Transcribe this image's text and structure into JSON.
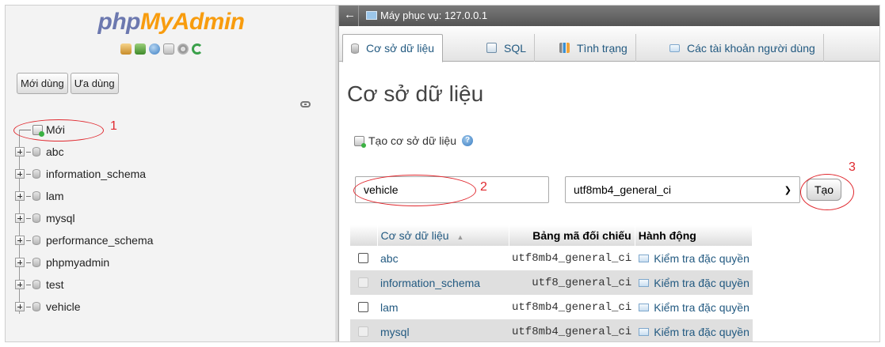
{
  "logo": {
    "php": "php",
    "myadmin": "MyAdmin"
  },
  "nav": {
    "icons": [
      "home-icon",
      "exit-icon",
      "help-icon",
      "docs-icon",
      "settings-icon",
      "reload-icon"
    ],
    "buttons": {
      "recent": "Mới dùng",
      "favorites": "Ưa dùng"
    },
    "new_label": "Mới",
    "databases": [
      "abc",
      "information_schema",
      "lam",
      "mysql",
      "performance_schema",
      "phpmyadmin",
      "test",
      "vehicle"
    ]
  },
  "topbar": {
    "server": "Máy phục vụ: 127.0.0.1"
  },
  "tabs": [
    {
      "label": "Cơ sở dữ liệu",
      "icon": "database-icon",
      "active": true
    },
    {
      "label": "SQL",
      "icon": "sql-icon",
      "active": false
    },
    {
      "label": "Tình trạng",
      "icon": "status-icon",
      "active": false
    },
    {
      "label": "Các tài khoản người dùng",
      "icon": "users-icon",
      "active": false
    }
  ],
  "main": {
    "title": "Cơ sở dữ liệu",
    "create_heading": "Tạo cơ sở dữ liệu",
    "db_name_value": "vehicle",
    "collation_selected": "utf8mb4_general_ci",
    "create_button": "Tạo"
  },
  "table": {
    "headers": {
      "name": "Cơ sở dữ liệu",
      "sort_indicator": "▲",
      "collation": "Bảng mã đối chiếu",
      "action": "Hành động"
    },
    "rows": [
      {
        "name": "abc",
        "collation": "utf8mb4_general_ci",
        "action": "Kiểm tra đặc quyền",
        "checkbox_disabled": false
      },
      {
        "name": "information_schema",
        "collation": "utf8_general_ci",
        "action": "Kiểm tra đặc quyền",
        "checkbox_disabled": true
      },
      {
        "name": "lam",
        "collation": "utf8mb4_general_ci",
        "action": "Kiểm tra đặc quyền",
        "checkbox_disabled": false
      },
      {
        "name": "mysql",
        "collation": "utf8mb4_general_ci",
        "action": "Kiểm tra đặc quyền",
        "checkbox_disabled": true
      }
    ]
  },
  "annotations": {
    "one": "1",
    "two": "2",
    "three": "3",
    "color": "#e0282e"
  },
  "colors": {
    "link": "#235a81",
    "logo_php": "#6c78af",
    "logo_myadmin": "#f89c0e",
    "topbar": "#616161"
  }
}
